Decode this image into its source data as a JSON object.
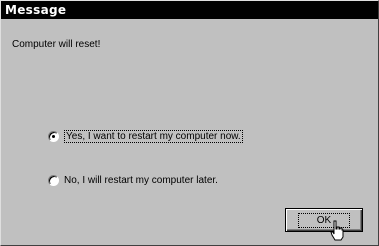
{
  "window": {
    "title": "Message"
  },
  "message": {
    "text": "Computer will reset!"
  },
  "options": [
    {
      "label": "Yes, I want to restart my computer now.",
      "selected": true
    },
    {
      "label": "No, I will restart my computer later.",
      "selected": false
    }
  ],
  "buttons": {
    "ok_label": "OK"
  },
  "colors": {
    "face": "#c0c0c0",
    "titlebar": "#000000",
    "title_text": "#ffffff"
  },
  "icons": {
    "cursor": "hand-pointer-icon"
  }
}
